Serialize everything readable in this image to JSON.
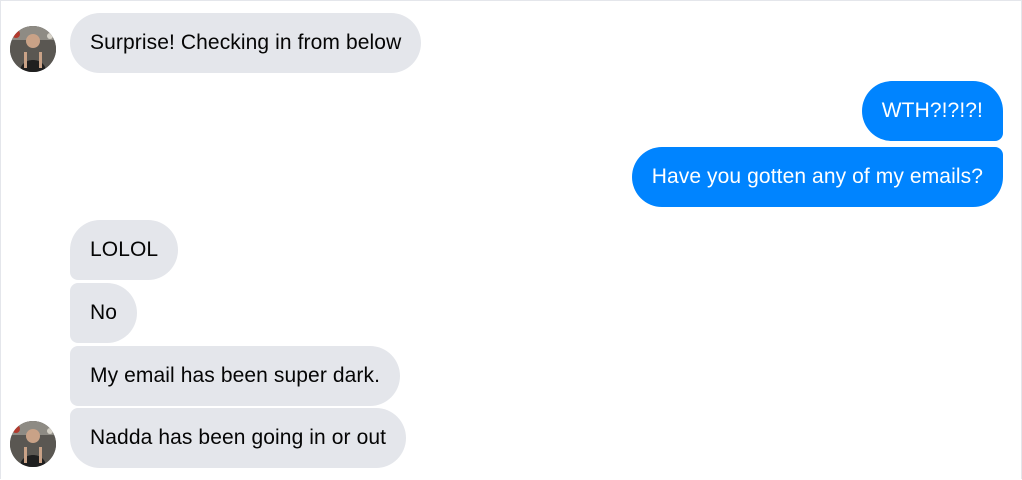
{
  "conversation": {
    "messages": [
      {
        "direction": "incoming",
        "text": "Surprise! Checking in from below",
        "avatar": "contact-avatar"
      },
      {
        "direction": "outgoing",
        "text": "WTH?!?!?!"
      },
      {
        "direction": "outgoing",
        "text": "Have you gotten any of my emails?"
      },
      {
        "direction": "incoming",
        "text": "LOLOL"
      },
      {
        "direction": "incoming",
        "text": "No"
      },
      {
        "direction": "incoming",
        "text": "My email has been super dark."
      },
      {
        "direction": "incoming",
        "text": "Nadda has been going in or out",
        "avatar": "contact-avatar"
      }
    ]
  },
  "colors": {
    "incoming_bubble": "#e4e6eb",
    "outgoing_bubble": "#0084ff",
    "incoming_text": "#050505",
    "outgoing_text": "#ffffff"
  }
}
